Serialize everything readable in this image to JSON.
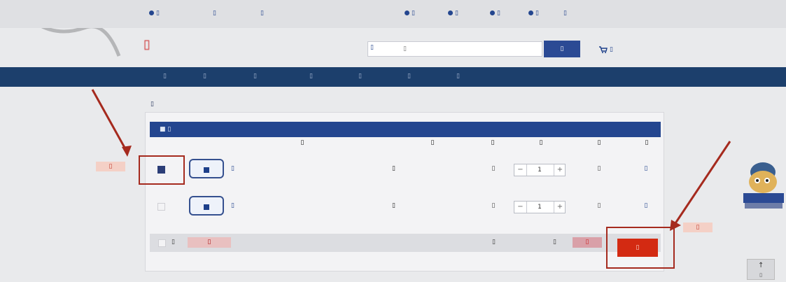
{
  "topbar": {
    "items": [
      "▯",
      "▯",
      "▯",
      "▯",
      "▯",
      "▯",
      "▯",
      "▯"
    ]
  },
  "header": {
    "logo_text": "▯",
    "search_category": "▯",
    "search_placeholder": "▯",
    "search_button": "▯",
    "cart_label": "▯"
  },
  "nav": {
    "items": [
      "▯",
      "▯",
      "▯",
      "▯",
      "▯",
      "▯",
      "▯"
    ]
  },
  "breadcrumb": "▯",
  "cart": {
    "header_title": "▯",
    "columns": [
      "▯",
      "▯",
      "▯",
      "▯",
      "▯",
      "▯"
    ],
    "rows": [
      {
        "checked": true,
        "name": "▯",
        "spec": "▯",
        "price": "▯",
        "qty": "1",
        "subtotal": "▯",
        "action": "▯"
      },
      {
        "checked": false,
        "name": "▯",
        "spec": "▯",
        "price": "▯",
        "qty": "1",
        "subtotal": "▯",
        "action": "▯"
      }
    ],
    "footer": {
      "select_all_label": "▯",
      "delete_selected_label": "▯",
      "selected_count_label": "▯",
      "total_label": "▯",
      "total_value": "▯",
      "checkout_label": "▯"
    }
  },
  "annotations": {
    "step1": "▯",
    "step2": "▯"
  },
  "back_to_top": "▯",
  "colors": {
    "nav_bg": "#1c3f6c",
    "panel_header_bg": "#24468f",
    "checkout_bg": "#d32a12",
    "annotation_red": "#a52a1e"
  }
}
